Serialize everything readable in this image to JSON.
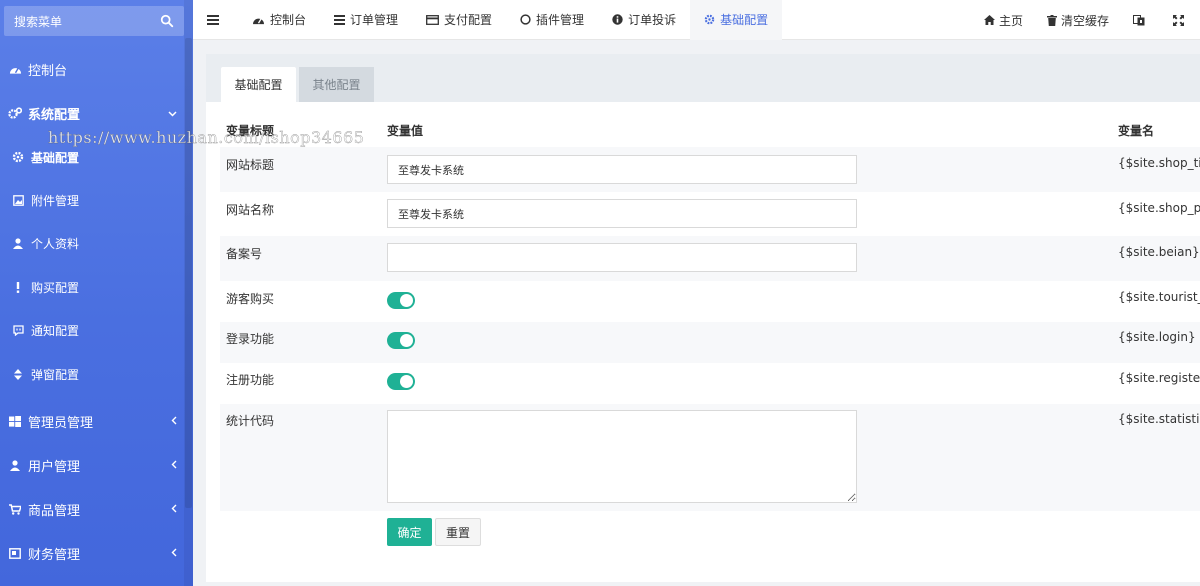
{
  "sidebar": {
    "search_placeholder": "搜索菜单",
    "items": [
      {
        "label": "控制台",
        "icon": "dashboard-icon"
      },
      {
        "label": "系统配置",
        "icon": "cogs-icon"
      },
      {
        "label": "管理员管理",
        "icon": "windows-icon"
      },
      {
        "label": "用户管理",
        "icon": "user-icon"
      },
      {
        "label": "商品管理",
        "icon": "cart-icon"
      },
      {
        "label": "财务管理",
        "icon": "book-icon"
      }
    ],
    "submenu": [
      {
        "label": "基础配置",
        "icon": "gear-icon"
      },
      {
        "label": "附件管理",
        "icon": "image-icon"
      },
      {
        "label": "个人资料",
        "icon": "user-icon"
      },
      {
        "label": "购买配置",
        "icon": "exclamation-icon"
      },
      {
        "label": "通知配置",
        "icon": "message-icon"
      },
      {
        "label": "弹窗配置",
        "icon": "sort-icon"
      }
    ]
  },
  "topnav": {
    "items": [
      {
        "label": "控制台",
        "icon": "dashboard-icon"
      },
      {
        "label": "订单管理",
        "icon": "list-icon"
      },
      {
        "label": "支付配置",
        "icon": "credit-card-icon"
      },
      {
        "label": "插件管理",
        "icon": "circle-icon"
      },
      {
        "label": "订单投诉",
        "icon": "info-icon"
      },
      {
        "label": "基础配置",
        "icon": "gear-icon"
      }
    ],
    "right": [
      {
        "label": "主页",
        "icon": "home-icon"
      },
      {
        "label": "清空缓存",
        "icon": "trash-icon"
      }
    ]
  },
  "tabs": [
    {
      "label": "基础配置",
      "active": true
    },
    {
      "label": "其他配置",
      "active": false
    }
  ],
  "table": {
    "headers": {
      "title": "变量标题",
      "value": "变量值",
      "name": "变量名"
    },
    "rows": [
      {
        "label": "网站标题",
        "type": "text",
        "value": "至尊发卡系统",
        "var": "{$site.shop_title}"
      },
      {
        "label": "网站名称",
        "type": "text",
        "value": "至尊发卡系统",
        "var": "{$site.shop_pet}"
      },
      {
        "label": "备案号",
        "type": "text",
        "value": "",
        "var": "{$site.beian}"
      },
      {
        "label": "游客购买",
        "type": "toggle",
        "value": true,
        "var": "{$site.tourist_buy}"
      },
      {
        "label": "登录功能",
        "type": "toggle",
        "value": true,
        "var": "{$site.login}"
      },
      {
        "label": "注册功能",
        "type": "toggle",
        "value": true,
        "var": "{$site.register}"
      },
      {
        "label": "统计代码",
        "type": "textarea",
        "value": "",
        "var": "{$site.statistics}"
      }
    ]
  },
  "buttons": {
    "submit": "确定",
    "reset": "重置"
  },
  "watermark": "https://www.huzhan.com/ishop34665",
  "colors": {
    "sidebar": "#4a6fe0",
    "accent": "#1fb195",
    "active_nav": "#4a6fe0"
  }
}
